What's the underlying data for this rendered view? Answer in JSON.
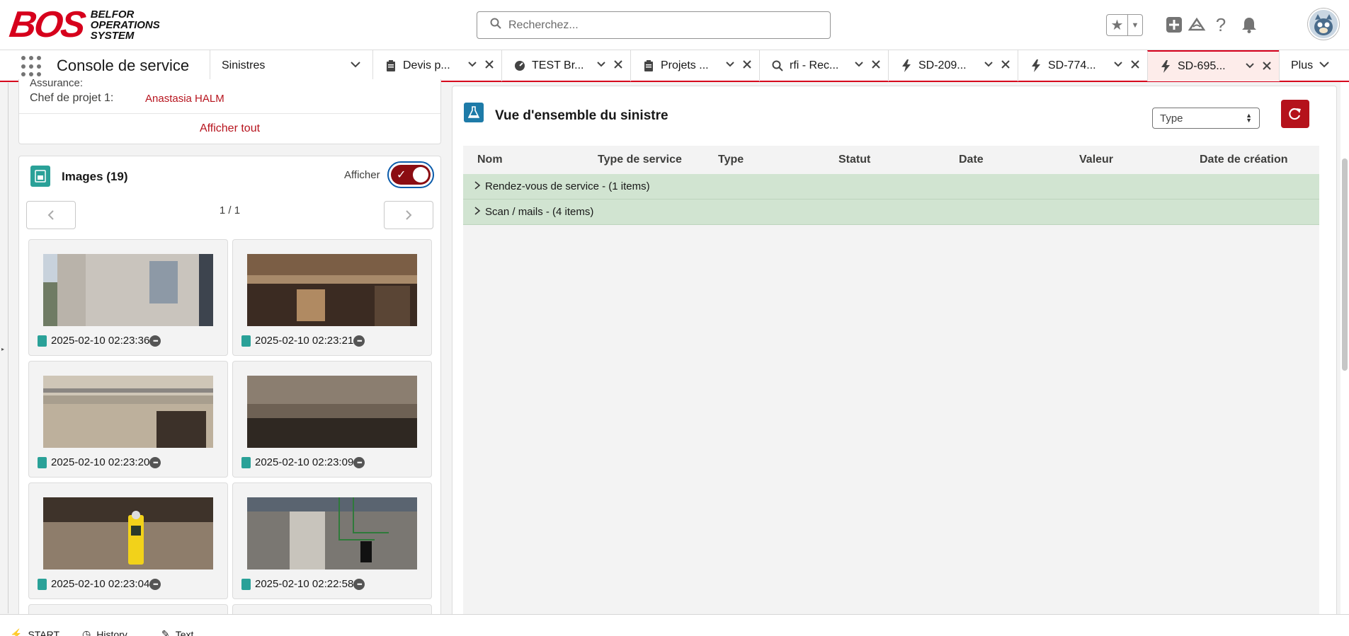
{
  "header": {
    "logo": {
      "brand": "BOS",
      "subtitle_lines": [
        "BELFOR",
        "OPERATIONS",
        "SYSTEM"
      ]
    },
    "search": {
      "placeholder": "Recherchez..."
    },
    "icons": [
      "star-icon",
      "chevron-down-icon",
      "plus-icon",
      "cloud-icon",
      "help-icon",
      "bell-icon",
      "avatar"
    ]
  },
  "nav": {
    "app_name": "Console de service",
    "object_menu": "Sinistres",
    "tabs": [
      {
        "label": "Devis p...",
        "icon": "clipboard-icon",
        "active": false
      },
      {
        "label": "TEST Br...",
        "icon": "gauge-icon",
        "active": false
      },
      {
        "label": "Projets ...",
        "icon": "clipboard-icon",
        "active": false
      },
      {
        "label": "rfi - Rec...",
        "icon": "search-icon",
        "active": false
      },
      {
        "label": "SD-209...",
        "icon": "bolt-icon",
        "active": false
      },
      {
        "label": "SD-774...",
        "icon": "bolt-icon",
        "active": false
      },
      {
        "label": "SD-695...",
        "icon": "bolt-icon",
        "active": true
      }
    ],
    "more_label": "Plus"
  },
  "details_card": {
    "field_partial": "Assurance:",
    "field_label": "Chef de projet 1:",
    "field_value": "Anastasia HALM",
    "view_all": "Afficher tout"
  },
  "images_card": {
    "title": "Images (19)",
    "toggle_label": "Afficher",
    "toggle_on": true,
    "page_info": "1 / 1",
    "images": [
      {
        "caption": "2025-02-10 02:23:36"
      },
      {
        "caption": "2025-02-10 02:23:21"
      },
      {
        "caption": "2025-02-10 02:23:20"
      },
      {
        "caption": "2025-02-10 02:23:09"
      },
      {
        "caption": "2025-02-10 02:23:04"
      },
      {
        "caption": "2025-02-10 02:22:58"
      }
    ]
  },
  "overview": {
    "title": "Vue d'ensemble du sinistre",
    "type_select": "Type",
    "columns": [
      "Nom",
      "Type de service",
      "Type",
      "Statut",
      "Date",
      "Valeur",
      "Date de création"
    ],
    "groups": [
      {
        "label": "Rendez-vous de service - (1 items)"
      },
      {
        "label": "Scan / mails - (4 items)"
      }
    ]
  },
  "bottom_bar": {
    "items": [
      "START",
      "History",
      "Text"
    ]
  },
  "colors": {
    "brand_red": "#d6001c",
    "link_red": "#b7141e",
    "toggle_bg": "#8b0d12",
    "group_green": "#d1e4d1",
    "teal_icon": "#2aa198"
  }
}
